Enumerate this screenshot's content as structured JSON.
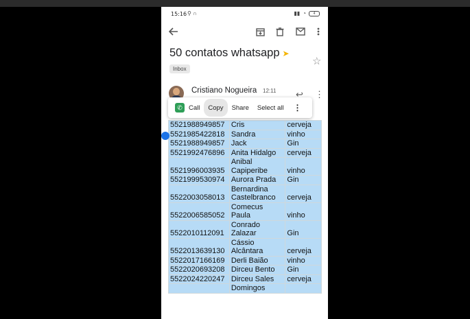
{
  "status_bar": {
    "time": "15:16",
    "battery": "4"
  },
  "email": {
    "subject": "50 contatos whatsapp",
    "label_chip": "Inbox",
    "sender": "Cristiano Nogueira",
    "time": "12:11"
  },
  "context_menu": {
    "items": [
      "Call",
      "Copy",
      "Share",
      "Select all"
    ]
  },
  "contacts_table": {
    "rows": [
      [
        "5521988949857",
        [
          "Cris"
        ],
        "cerveja"
      ],
      [
        "5521985422818",
        [
          "Sandra"
        ],
        "vinho"
      ],
      [
        "5521988949857",
        [
          "Jack"
        ],
        "Gin"
      ],
      [
        "5521992476896",
        [
          "Anita Hidalgo"
        ],
        "cerveja"
      ],
      [
        "5521996003935",
        [
          "Anibal",
          "Capiperibe"
        ],
        "vinho"
      ],
      [
        "5521999530974",
        [
          "Aurora Prada"
        ],
        "Gin"
      ],
      [
        "5522003058013",
        [
          "Bernardina",
          "Castelbranco"
        ],
        "cerveja"
      ],
      [
        "5522006585052",
        [
          "Comecus",
          "Paula"
        ],
        "vinho"
      ],
      [
        "5522010112091",
        [
          "Conrado",
          "Zalazar"
        ],
        "Gin"
      ],
      [
        "5522013639130",
        [
          "Cássio",
          "Alcântara"
        ],
        "cerveja"
      ],
      [
        "5522017166169",
        [
          "Derli Baião"
        ],
        "vinho"
      ],
      [
        "5522020693208",
        [
          "Dirceu Bento"
        ],
        "Gin"
      ],
      [
        "5522024220247",
        [
          "Dirceu Sales"
        ],
        "cerveja"
      ],
      [
        "",
        [
          "Domingos"
        ],
        ""
      ]
    ]
  }
}
